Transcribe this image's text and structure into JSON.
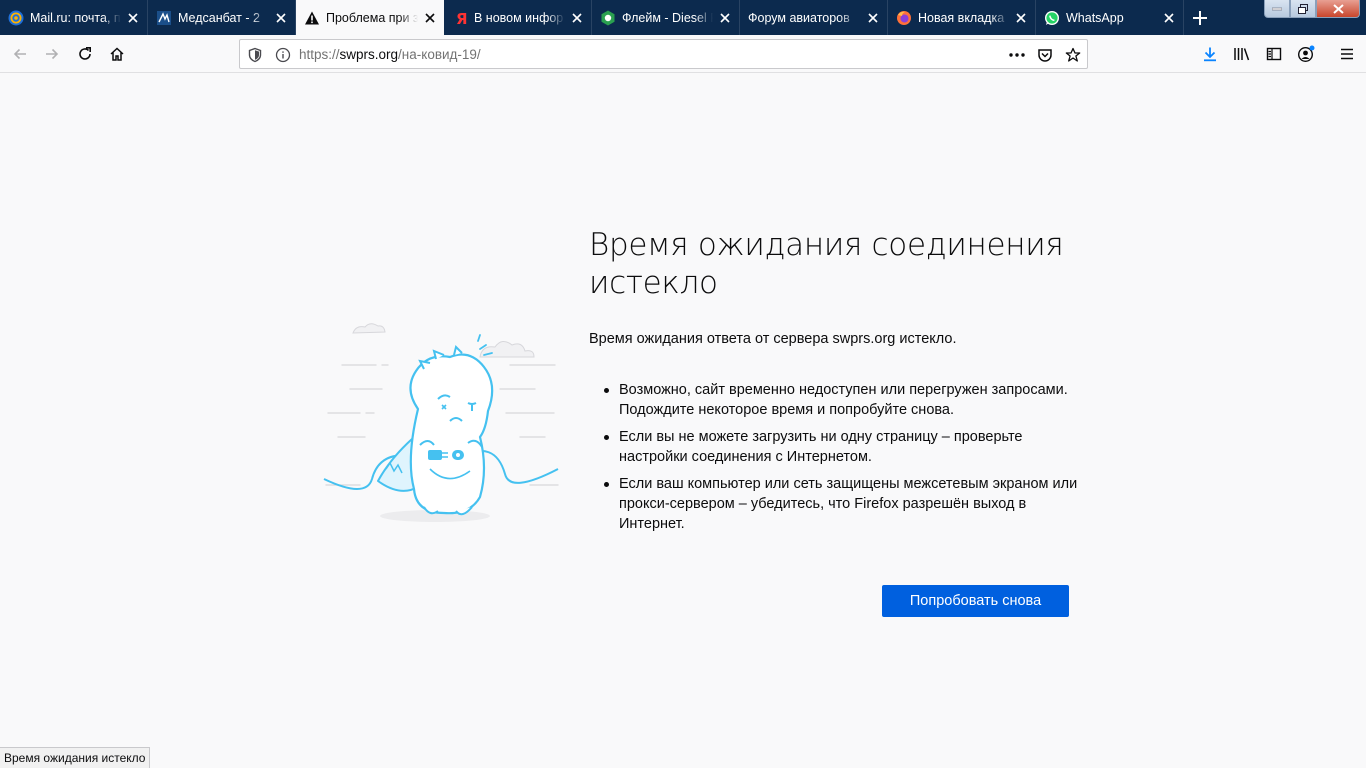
{
  "tabs": [
    {
      "title": "Mail.ru: почта, п",
      "icon": "mailru-at-icon",
      "active": false
    },
    {
      "title": "Медсанбат - 2",
      "icon": "medsanbat-icon",
      "active": false
    },
    {
      "title": "Проблема при з",
      "icon": "warning-icon",
      "active": true
    },
    {
      "title": "В новом инфор",
      "icon": "yandex-icon",
      "active": false
    },
    {
      "title": "Флейм - Diesel F",
      "icon": "diesel-icon",
      "active": false
    },
    {
      "title": "Форум авиаторов",
      "icon": "",
      "active": false
    },
    {
      "title": "Новая вкладка",
      "icon": "firefox-icon",
      "active": false
    },
    {
      "title": "WhatsApp",
      "icon": "whatsapp-icon",
      "active": false
    }
  ],
  "url": {
    "scheme": "https://",
    "host": "swprs.org",
    "path": "/на-ковид-19/"
  },
  "error": {
    "title": "Время ожидания соединения истекло",
    "description": "Время ожидания ответа от сервера swprs.org истекло.",
    "items": [
      "Возможно, сайт временно недоступен или перегружен запросами. Подождите некоторое время и попробуйте снова.",
      "Если вы не можете загрузить ни одну страницу – проверьте настройки соединения с Интернетом.",
      "Если ваш компьютер или сеть защищены межсетевым экраном или прокси-сервером – убедитесь, что Firefox разрешён выход в Интернет."
    ],
    "retry_label": "Попробовать снова"
  },
  "status_text": "Время ожидания истекло",
  "colors": {
    "tabstrip": "#0c2a4e",
    "accent_blue": "#0060df",
    "illustration": "#45c1f0"
  }
}
